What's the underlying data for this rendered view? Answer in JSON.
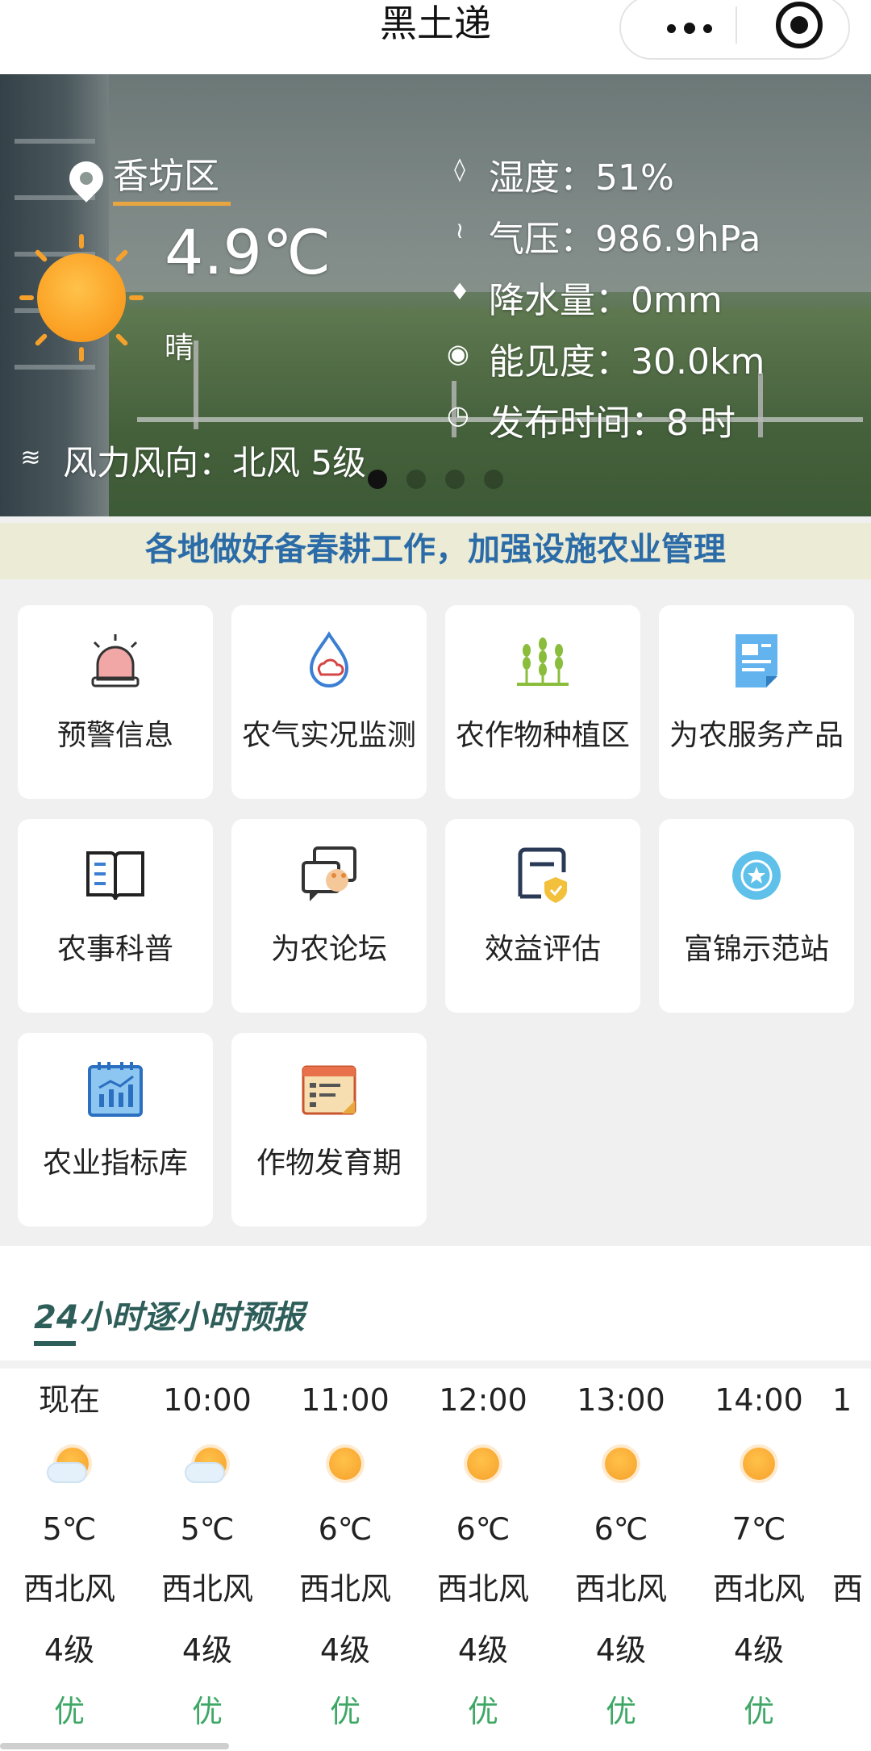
{
  "app": {
    "title": "黑土递"
  },
  "weather": {
    "location": "香坊区",
    "temperature": "4.9℃",
    "condition": "晴",
    "wind": "风力风向：北风 5级",
    "humidity": "湿度：51%",
    "pressure": "气压：986.9hPa",
    "precipitation": "降水量：0mm",
    "visibility": "能见度：30.0km",
    "publish_time": "发布时间：8 时",
    "carousel_active_index": 0,
    "carousel_count": 4
  },
  "notice": "各地做好备春耕工作，加强设施农业管理",
  "services": [
    {
      "label": "预警信息",
      "icon": "alarm-icon"
    },
    {
      "label": "农气实况监测",
      "icon": "water-drop-cloud-icon"
    },
    {
      "label": "农作物种植区",
      "icon": "wheat-icon"
    },
    {
      "label": "为农服务产品",
      "icon": "document-icon"
    },
    {
      "label": "农事科普",
      "icon": "open-book-icon"
    },
    {
      "label": "为农论坛",
      "icon": "chat-bubbles-icon"
    },
    {
      "label": "效益评估",
      "icon": "shield-document-icon"
    },
    {
      "label": "富锦示范站",
      "icon": "award-badge-icon"
    },
    {
      "label": "农业指标库",
      "icon": "chart-calendar-icon"
    },
    {
      "label": "作物发育期",
      "icon": "schedule-icon"
    }
  ],
  "forecast": {
    "title": "24小时逐小时预报",
    "hours": [
      {
        "time": "现在",
        "icon": "partly-cloudy-icon",
        "temp": "5℃",
        "wind": "西北风",
        "level": "4级",
        "aqi": "优"
      },
      {
        "time": "10:00",
        "icon": "partly-cloudy-icon",
        "temp": "5℃",
        "wind": "西北风",
        "level": "4级",
        "aqi": "优"
      },
      {
        "time": "11:00",
        "icon": "sunny-icon",
        "temp": "6℃",
        "wind": "西北风",
        "level": "4级",
        "aqi": "优"
      },
      {
        "time": "12:00",
        "icon": "sunny-icon",
        "temp": "6℃",
        "wind": "西北风",
        "level": "4级",
        "aqi": "优"
      },
      {
        "time": "13:00",
        "icon": "sunny-icon",
        "temp": "6℃",
        "wind": "西北风",
        "level": "4级",
        "aqi": "优"
      },
      {
        "time": "14:00",
        "icon": "sunny-icon",
        "temp": "7℃",
        "wind": "西北风",
        "level": "4级",
        "aqi": "优"
      },
      {
        "time": "1",
        "icon": "sunny-icon",
        "temp": "",
        "wind": "西",
        "level": "",
        "aqi": ""
      }
    ]
  },
  "colors": {
    "notice_text": "#2b6ca8",
    "section_title": "#2e5e59",
    "aqi_good": "#3fa866",
    "sun": "#f7a02b"
  }
}
